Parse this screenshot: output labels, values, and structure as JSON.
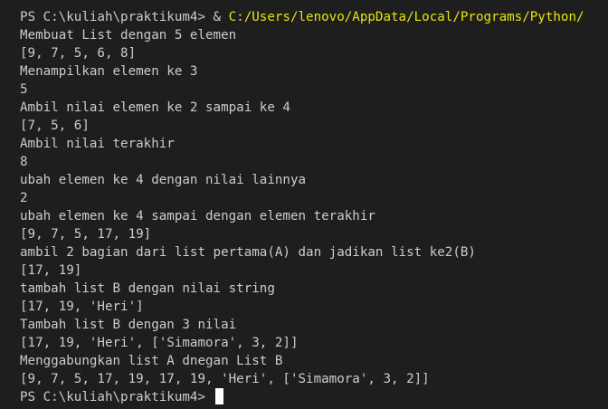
{
  "terminal": {
    "prompt": "PS C:\\kuliah\\praktikum4>",
    "command_operator": "&",
    "command_path": "C:/Users/lenovo/AppData/Local/Programs/Python/",
    "output": [
      "Membuat List dengan 5 elemen",
      "[9, 7, 5, 6, 8]",
      "Menampilkan elemen ke 3",
      "5",
      "Ambil nilai elemen ke 2 sampai ke 4",
      "[7, 5, 6]",
      "Ambil nilai terakhir",
      "8",
      "ubah elemen ke 4 dengan nilai lainnya",
      "2",
      "ubah elemen ke 4 sampai dengan elemen terakhir",
      "[9, 7, 5, 17, 19]",
      "ambil 2 bagian dari list pertama(A) dan jadikan list ke2(B)",
      "[17, 19]",
      "tambah list B dengan nilai string",
      "[17, 19, 'Heri']",
      "Tambah list B dengan 3 nilai",
      "[17, 19, 'Heri', ['Simamora', 3, 2]]",
      "Menggabungkan list A dnegan List B",
      "[9, 7, 5, 17, 19, 17, 19, 'Heri', ['Simamora', 3, 2]]"
    ],
    "final_prompt": "PS C:\\kuliah\\praktikum4>",
    "colors": {
      "background": "#1e1e1e",
      "text": "#cccccc",
      "command_path": "#e5e510",
      "cursor": "#ffffff"
    }
  }
}
